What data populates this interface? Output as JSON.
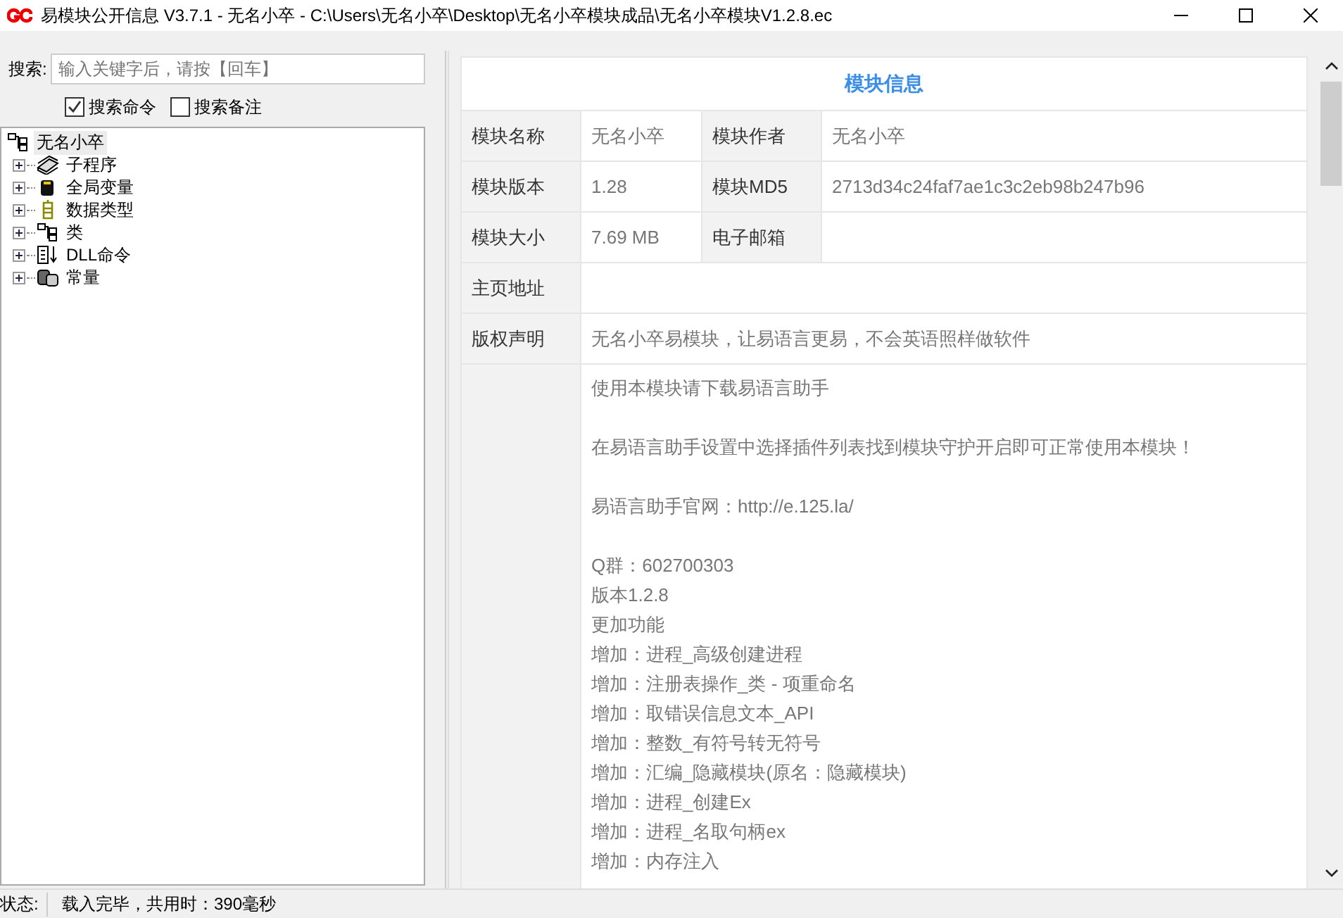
{
  "window": {
    "title": "易模块公开信息 V3.7.1 - 无名小卒 - C:\\Users\\无名小卒\\Desktop\\无名小卒模块成品\\无名小卒模块V1.2.8.ec"
  },
  "search": {
    "label": "搜索:",
    "placeholder": "输入关键字后，请按【回车】"
  },
  "options": [
    {
      "label": "搜索命令",
      "checked": true
    },
    {
      "label": "搜索备注",
      "checked": false
    }
  ],
  "tree": {
    "label": "无名小卒",
    "kind": "module",
    "selected": true,
    "children": [
      {
        "label": "子程序",
        "kind": "sub",
        "expanded": false,
        "selected": false
      },
      {
        "label": "全局变量",
        "kind": "var",
        "expanded": false,
        "selected": false
      },
      {
        "label": "数据类型",
        "kind": "type",
        "expanded": false,
        "selected": false
      },
      {
        "label": "类",
        "kind": "class",
        "expanded": false,
        "selected": false
      },
      {
        "label": "DLL命令",
        "kind": "dll",
        "expanded": false,
        "selected": false
      },
      {
        "label": "常量",
        "kind": "const",
        "expanded": false,
        "selected": false
      }
    ]
  },
  "info": {
    "title": "模块信息",
    "pairs": [
      [
        {
          "label": "模块名称",
          "value": "无名小卒"
        },
        {
          "label": "模块作者",
          "value": "无名小卒"
        }
      ],
      [
        {
          "label": "模块版本",
          "value": "1.28"
        },
        {
          "label": "模块MD5",
          "value": "2713d34c24faf7ae1c3c2eb98b247b96"
        }
      ],
      [
        {
          "label": "模块大小",
          "value": "7.69 MB"
        },
        {
          "label": "电子邮箱"
        }
      ]
    ],
    "wide": [
      {
        "label": "主页地址"
      },
      {
        "label": "版权声明",
        "value": "无名小卒易模块，让易语言更易，不会英语照样做软件"
      }
    ],
    "notes": [
      [
        "使用本模块请下载易语言助手"
      ],
      [
        "在易语言助手设置中选择插件列表找到模块守护开启即可正常使用本模块！"
      ],
      [
        "易语言助手官网：http://e.125.la/"
      ],
      [
        "Q群：602700303",
        "版本1.2.8",
        "更加功能",
        "增加：进程_高级创建进程",
        "增加：注册表操作_类 - 项重命名",
        "增加：取错误信息文本_API",
        "增加：整数_有符号转无符号",
        "增加：汇编_隐藏模块(原名：隐藏模块)",
        "增加：进程_创建Ex",
        "增加：进程_名取句柄ex",
        "增加：内存注入"
      ]
    ]
  },
  "status_bar": {
    "label": "状态:",
    "text": "载入完毕，共用时：390毫秒"
  }
}
